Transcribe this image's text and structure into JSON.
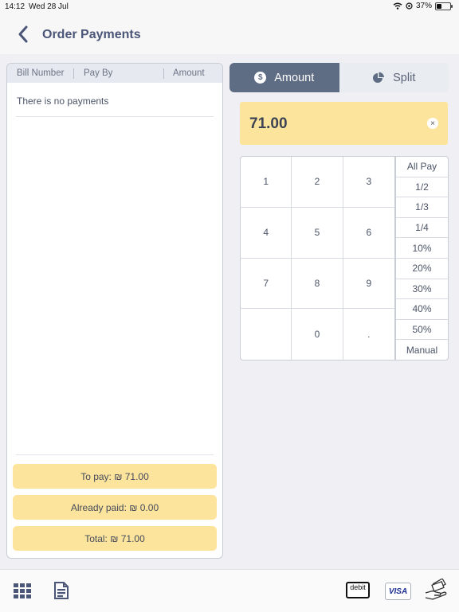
{
  "status_bar": {
    "time": "14:12",
    "date": "Wed 28 Jul",
    "battery": "37%"
  },
  "nav": {
    "title": "Order Payments"
  },
  "table": {
    "headers": [
      "Bill Number",
      "Pay By",
      "Amount"
    ],
    "empty_message": "There is no payments"
  },
  "summary": {
    "to_pay": "To pay: ₪ 71.00",
    "already_paid": "Already paid: ₪ 0.00",
    "total": "Total: ₪ 71.00"
  },
  "tabs": {
    "amount": "Amount",
    "split": "Split",
    "amount_icon_glyph": "$"
  },
  "amount_display": {
    "value": "71.00",
    "clear_glyph": "×"
  },
  "keypad": {
    "keys": [
      "1",
      "2",
      "3",
      "4",
      "5",
      "6",
      "7",
      "8",
      "9",
      "",
      "0",
      "."
    ]
  },
  "quick_amounts": [
    "All Pay",
    "1/2",
    "1/3",
    "1/4",
    "10%",
    "20%",
    "30%",
    "40%",
    "50%",
    "Manual"
  ],
  "toolbar": {
    "debit_label": "debit",
    "visa_label": "VISA"
  },
  "icons": {
    "back": "chevron-left-icon",
    "wifi": "wifi-icon",
    "battery": "battery-icon",
    "amount_tab": "dollar-icon",
    "split_tab": "pie-chart-icon",
    "clear": "close-icon",
    "apps": "grid-icon",
    "bill": "receipt-icon",
    "debit": "debit-card-icon",
    "visa": "visa-card-icon",
    "cash": "cash-hand-icon"
  },
  "colors": {
    "accent": "#5f6d84",
    "highlight": "#fde49c",
    "title": "#4a5578"
  }
}
